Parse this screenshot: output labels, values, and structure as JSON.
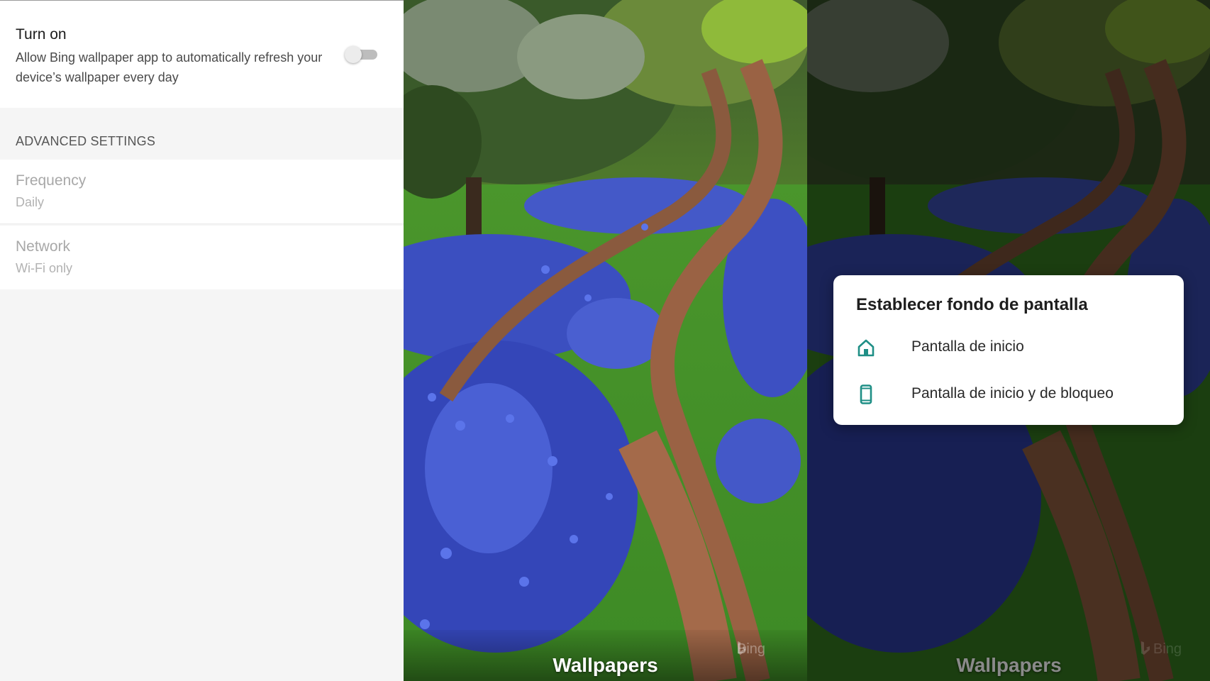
{
  "settings": {
    "turn_on": {
      "title": "Turn on",
      "description": "Allow Bing wallpaper app to automatically refresh your device’s wallpaper every day",
      "toggle_state": "off"
    },
    "section_header": "ADVANCED SETTINGS",
    "frequency": {
      "title": "Frequency",
      "value": "Daily"
    },
    "network": {
      "title": "Network",
      "value": "Wi-Fi only"
    }
  },
  "preview_left": {
    "title": "Wallpapers",
    "watermark": "Bing"
  },
  "preview_right": {
    "title": "Wallpapers",
    "watermark": "Bing"
  },
  "dialog": {
    "title": "Establecer fondo de pantalla",
    "options": [
      {
        "label": "Pantalla de inicio",
        "icon": "home-icon"
      },
      {
        "label": "Pantalla de inicio y de bloqueo",
        "icon": "phone-icon"
      }
    ]
  },
  "colors": {
    "accent": "#1f8f86",
    "panel_bg": "#f5f5f5",
    "card_bg": "#ffffff"
  }
}
